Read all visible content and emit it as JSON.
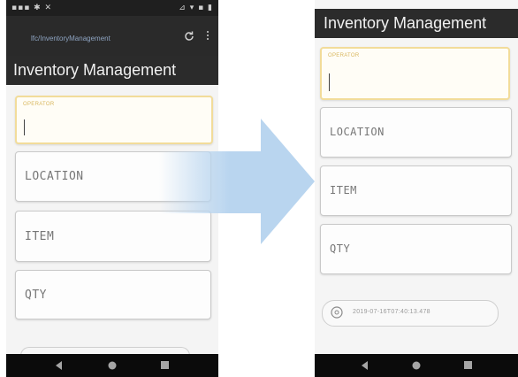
{
  "status_bar": {
    "left_text": "▪▪▪ ✱ ✕",
    "right_text": "⊿ ▾ ▪ ▮"
  },
  "browser": {
    "url": "lfc/InventoryManagement"
  },
  "app": {
    "title": "Inventory Management"
  },
  "form": {
    "operator_label": "OPERATOR",
    "location_placeholder": "LOCATION",
    "item_placeholder": "ITEM",
    "qty_placeholder": "QTY"
  },
  "history": {
    "entry_text": "2019-07-16T07:40:13.478"
  },
  "colors": {
    "header_bg": "#2b2b2b",
    "active_field_border": "#f2dc9a",
    "operator_label": "#d9b75e",
    "arrow_fill": "#b9d5ef"
  },
  "icons": {
    "reload": "reload-icon",
    "menu": "kebab-menu-icon",
    "back": "nav-back-icon",
    "home": "nav-home-icon",
    "recent": "nav-recent-icon",
    "history": "clock-icon",
    "transition": "right-arrow-icon"
  }
}
